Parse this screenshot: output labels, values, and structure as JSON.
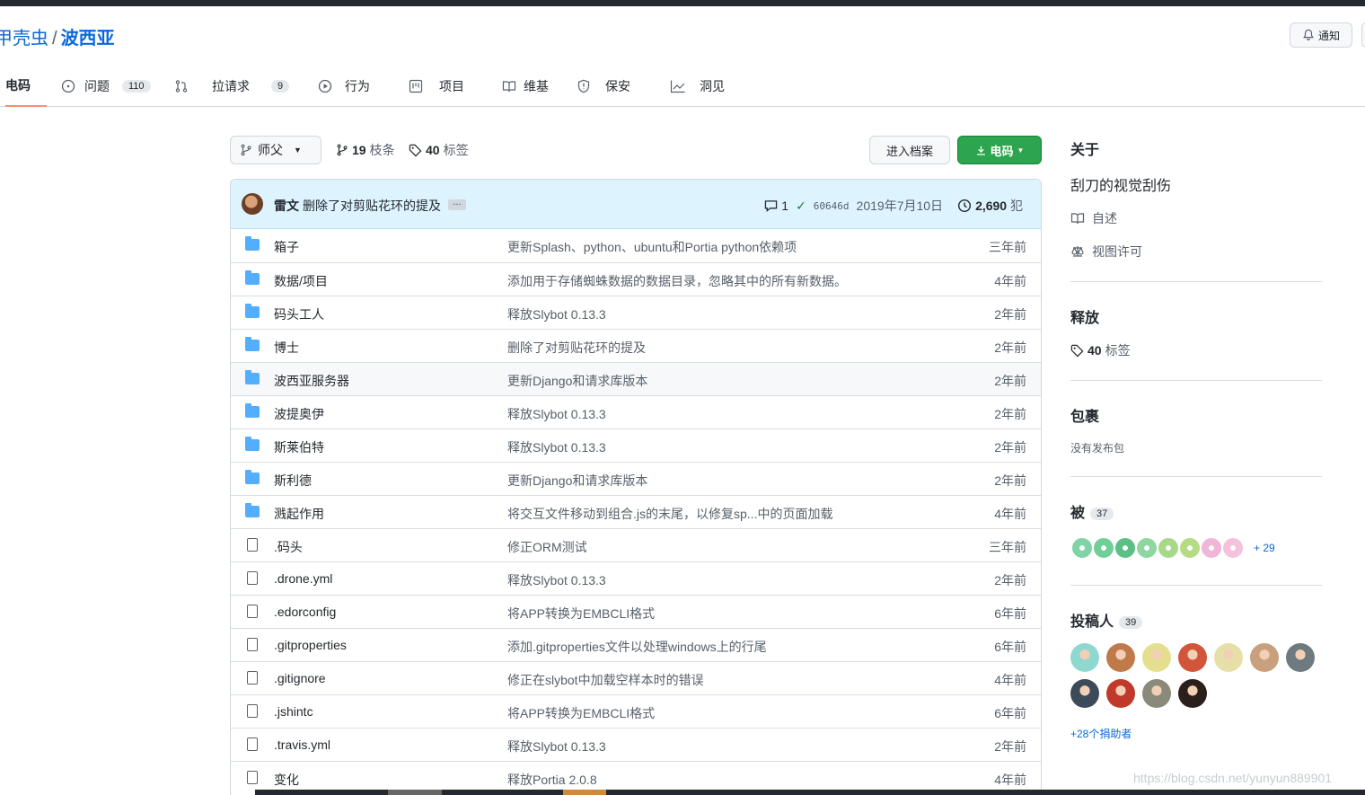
{
  "repo": {
    "owner": "甲壳虫",
    "separator": "/",
    "name": "波西亚"
  },
  "header": {
    "notify_label": "通知"
  },
  "tabs": [
    {
      "label": "电码",
      "icon": "code-icon",
      "active": true
    },
    {
      "label": "问题",
      "icon": "issue-icon",
      "count": "110"
    },
    {
      "label": "拉请求",
      "icon": "pull-request-icon",
      "count": "9"
    },
    {
      "label": "行为",
      "icon": "play-icon"
    },
    {
      "label": "项目",
      "icon": "project-icon"
    },
    {
      "label": "维基",
      "icon": "book-icon"
    },
    {
      "label": "保安",
      "icon": "shield-icon"
    },
    {
      "label": "洞见",
      "icon": "graph-icon"
    }
  ],
  "toolbar": {
    "branch": "师父",
    "branches_count": "19",
    "branches_label": "枝条",
    "tags_count": "40",
    "tags_label": "标签",
    "goto_file": "进入档案",
    "code_button": "电码"
  },
  "commit": {
    "author": "雷文",
    "message": "删除了对剪贴花环的提及",
    "ellipsis": "…",
    "comments": "1",
    "sha": "60646d",
    "date": "2019年7月10日",
    "commits_count": "2,690",
    "commits_label": "犯"
  },
  "files": [
    {
      "type": "dir",
      "name": "箱子",
      "message": "更新Splash、python、ubuntu和Portia python依赖项",
      "age": "三年前"
    },
    {
      "type": "dir",
      "name": "数据/项目",
      "message": "添加用于存储蜘蛛数据的数据目录，忽略其中的所有新数据。",
      "age": "4年前"
    },
    {
      "type": "dir",
      "name": "码头工人",
      "message": "释放Slybot 0.13.3",
      "age": "2年前"
    },
    {
      "type": "dir",
      "name": "博士",
      "message": "删除了对剪贴花环的提及",
      "age": "2年前"
    },
    {
      "type": "dir",
      "name": "波西亚服务器",
      "message": "更新Django和请求库版本",
      "age": "2年前"
    },
    {
      "type": "dir",
      "name": "波提奥伊",
      "message": "释放Slybot 0.13.3",
      "age": "2年前"
    },
    {
      "type": "dir",
      "name": "斯莱伯特",
      "message": "释放Slybot 0.13.3",
      "age": "2年前"
    },
    {
      "type": "dir",
      "name": "斯利德",
      "message": "更新Django和请求库版本",
      "age": "2年前"
    },
    {
      "type": "dir",
      "name": "溅起作用",
      "message": "将交互文件移动到组合.js的末尾，以修复sp...中的页面加载",
      "age": "4年前"
    },
    {
      "type": "file",
      "name": ".码头",
      "message": "修正ORM测试",
      "age": "三年前"
    },
    {
      "type": "file",
      "name": ".drone.yml",
      "message": "释放Slybot 0.13.3",
      "age": "2年前"
    },
    {
      "type": "file",
      "name": ".edorconfig",
      "message": "将APP转换为EMBCLI格式",
      "age": "6年前"
    },
    {
      "type": "file",
      "name": ".gitproperties",
      "message": "添加.gitproperties文件以处理windows上的行尾",
      "age": "6年前"
    },
    {
      "type": "file",
      "name": ".gitignore",
      "message": "修正在slybot中加载空样本时的错误",
      "age": "4年前"
    },
    {
      "type": "file",
      "name": ".jshintc",
      "message": "将APP转换为EMBCLI格式",
      "age": "6年前"
    },
    {
      "type": "file",
      "name": ".travis.yml",
      "message": "释放Slybot 0.13.3",
      "age": "2年前"
    },
    {
      "type": "file",
      "name": "变化",
      "message": "释放Portia 2.0.8",
      "age": "4年前"
    }
  ],
  "sidebar": {
    "about_title": "关于",
    "about_desc": "刮刀的视觉刮伤",
    "readme": "自述",
    "license": "视图许可",
    "releases_title": "释放",
    "releases_tags_count": "40",
    "releases_tags_label": "标签",
    "packages_title": "包裹",
    "packages_empty": "没有发布包",
    "stargazers_title": "被",
    "stargazers_count": "37",
    "stargazers_more": "+ 29",
    "stargazer_colors": [
      "#7fd3a6",
      "#6fcf97",
      "#5cbf85",
      "#8fd6a0",
      "#a8d88a",
      "#b4dc84",
      "#f0b6d8",
      "#f4c2dc"
    ],
    "contributors_title": "投稿人",
    "contributors_count": "39",
    "contributor_colors": [
      "#8ed8d0",
      "#c07a4a",
      "#e3df8e",
      "#d0553b",
      "#e7dfa8",
      "#c8a07e",
      "#6e7a80",
      "#3d4a5a",
      "#c0392b",
      "#8a8a7a",
      "#2a1f1a"
    ],
    "contributors_more": "+28个捐助者"
  },
  "watermark": "https://blog.csdn.net/yunyun889901"
}
